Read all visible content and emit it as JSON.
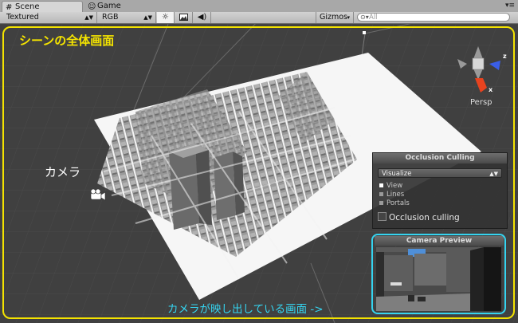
{
  "tabs": [
    {
      "label": "Scene",
      "icon": "grid-icon"
    },
    {
      "label": "Game",
      "icon": "game-icon"
    }
  ],
  "toolbar": {
    "render_mode": "Textured",
    "color_mode": "RGB",
    "toggle_lighting": "sun-icon",
    "toggle_skybox": "image-icon",
    "toggle_audio": "speaker-icon",
    "gizmos_label": "Gizmos",
    "search_placeholder": "All"
  },
  "annotations": {
    "scene_overview": "シーンの全体画面",
    "camera": "カメラ",
    "camera_view": "カメラが映し出している画面 ->"
  },
  "scene_gizmo": {
    "projection": "Persp",
    "axis_labels": [
      "z",
      "x"
    ]
  },
  "occlusion_culling": {
    "title": "Occlusion Culling",
    "mode": "Visualize",
    "options": [
      "View",
      "Lines",
      "Portals"
    ],
    "selected_option": "View",
    "checkbox_label": "Occlusion culling",
    "checked": false
  },
  "camera_preview": {
    "title": "Camera Preview"
  },
  "colors": {
    "annotation_yellow": "#f4e300",
    "annotation_cyan": "#35d4f0",
    "viewport_bg": "#404040"
  }
}
